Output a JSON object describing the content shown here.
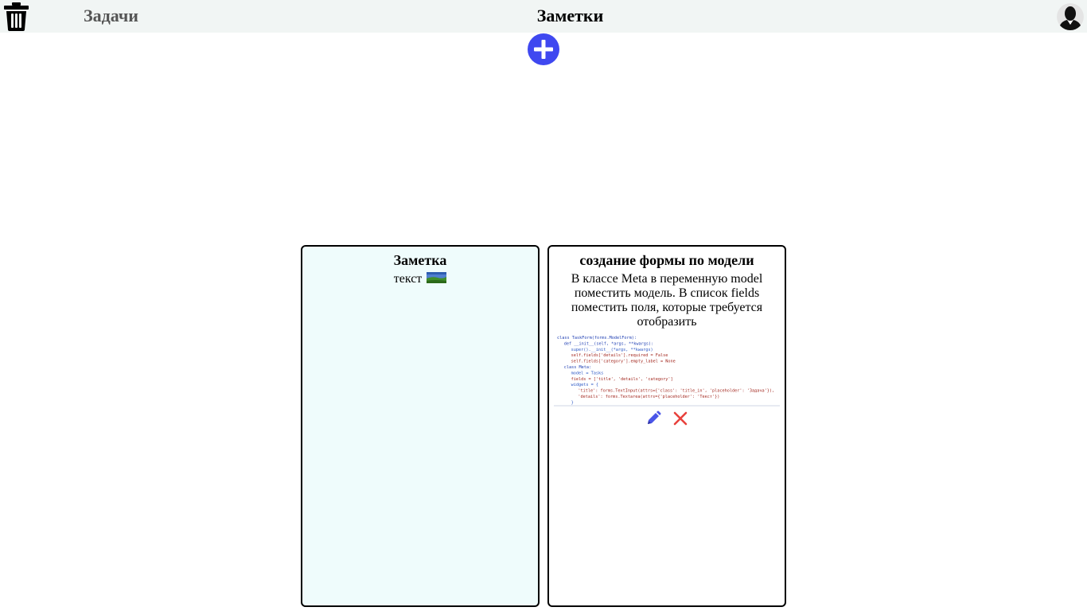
{
  "header": {
    "nav_tasks": "Задачи",
    "title": "Заметки",
    "icons": {
      "trash": "trash-icon",
      "avatar": "user-avatar-icon",
      "add": "plus-circle-icon"
    }
  },
  "notes": [
    {
      "title": "Заметка",
      "text": "текст",
      "image": "landscape-thumbnail"
    },
    {
      "title": "создание формы по модели",
      "text": "В классе Meta в переменную model поместить модель. В список fields поместить поля, которые требуется отобразить",
      "image": "code-screenshot",
      "code_lines": [
        "class TaskForm(forms.ModelForm):",
        "    def __init__(self, *args, **kwargs):",
        "        super().__init__(*args, **kwargs)",
        "        self.fields['details'].required = False",
        "        self.fields['category'].empty_label = None",
        "    class Meta:",
        "        model = Tasks",
        "        fields = ['title', 'details', 'category']",
        "        widgets = {",
        "            'title': forms.TextInput(attrs={'class': 'title_in', 'placeholder': 'Задача'}),",
        "            'details': forms.Textarea(attrs={'placeholder': 'Текст'})",
        "        }"
      ],
      "actions": {
        "edit": "pencil-icon",
        "delete": "close-icon"
      }
    }
  ],
  "colors": {
    "accent": "#3f48f0",
    "delete": "#e8413c",
    "topbar": "#f1f5f4",
    "card_bg": "#effcfc"
  }
}
